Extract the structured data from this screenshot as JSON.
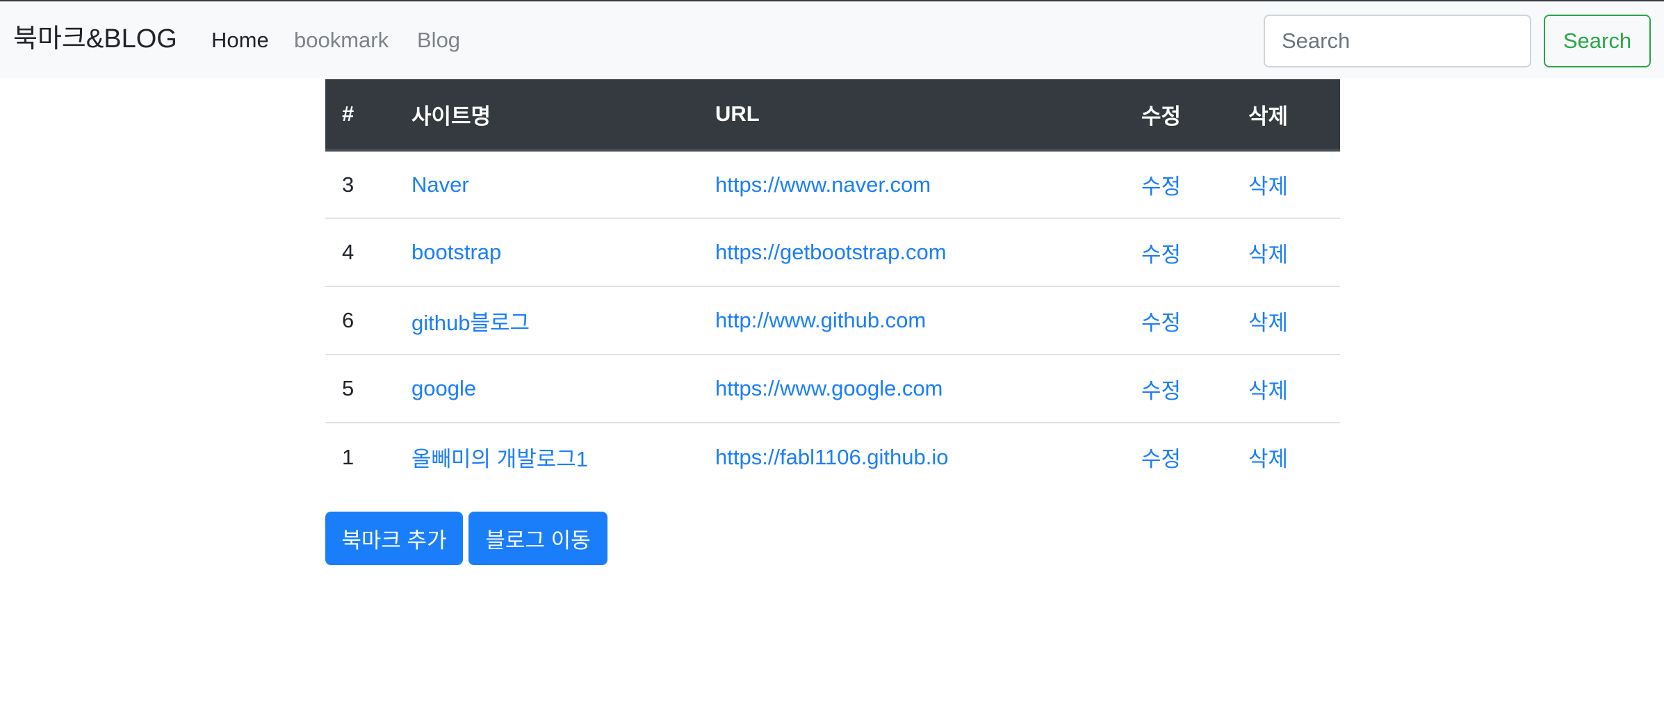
{
  "navbar": {
    "brand": "북마크&BLOG",
    "links": [
      {
        "label": "Home"
      },
      {
        "label": "bookmark"
      },
      {
        "label": "Blog"
      }
    ],
    "search": {
      "placeholder": "Search",
      "button_label": "Search"
    }
  },
  "table": {
    "headers": {
      "num": "#",
      "site": "사이트명",
      "url": "URL",
      "edit": "수정",
      "delete": "삭제"
    },
    "rows": [
      {
        "num": "3",
        "site": "Naver",
        "url": "https://www.naver.com",
        "edit": "수정",
        "delete": "삭제"
      },
      {
        "num": "4",
        "site": "bootstrap",
        "url": "https://getbootstrap.com",
        "edit": "수정",
        "delete": "삭제"
      },
      {
        "num": "6",
        "site": "github블로그",
        "url": "http://www.github.com",
        "edit": "수정",
        "delete": "삭제"
      },
      {
        "num": "5",
        "site": "google",
        "url": "https://www.google.com",
        "edit": "수정",
        "delete": "삭제"
      },
      {
        "num": "1",
        "site": "올빼미의 개발로그1",
        "url": "https://fabl1106.github.io",
        "edit": "수정",
        "delete": "삭제"
      }
    ]
  },
  "actions": {
    "add_bookmark": "북마크 추가",
    "go_blog": "블로그 이동"
  },
  "colors": {
    "navbar_bg": "#f8f9fa",
    "table_header_bg": "#343a40",
    "link": "#1a7efb",
    "primary_button": "#1a7efb",
    "search_button": "#28a745"
  }
}
